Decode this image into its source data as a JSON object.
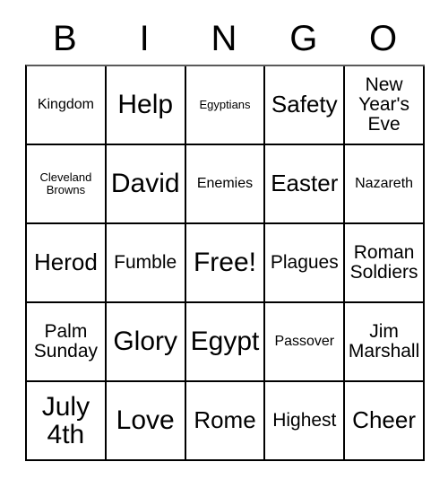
{
  "card": {
    "headers": [
      "B",
      "I",
      "N",
      "G",
      "O"
    ],
    "rows": [
      [
        {
          "text": "Kingdom",
          "size": "s-sm"
        },
        {
          "text": "Help",
          "size": "s-xl"
        },
        {
          "text": "Egyptians",
          "size": "s-xs"
        },
        {
          "text": "Safety",
          "size": "s-lg"
        },
        {
          "text": "New Year's Eve",
          "size": "s-md"
        }
      ],
      [
        {
          "text": "Cleveland Browns",
          "size": "s-xs"
        },
        {
          "text": "David",
          "size": "s-xl"
        },
        {
          "text": "Enemies",
          "size": "s-sm"
        },
        {
          "text": "Easter",
          "size": "s-lg"
        },
        {
          "text": "Nazareth",
          "size": "s-sm"
        }
      ],
      [
        {
          "text": "Herod",
          "size": "s-lg"
        },
        {
          "text": "Fumble",
          "size": "s-md"
        },
        {
          "text": "Free!",
          "size": "s-xl"
        },
        {
          "text": "Plagues",
          "size": "s-md"
        },
        {
          "text": "Roman Soldiers",
          "size": "s-md"
        }
      ],
      [
        {
          "text": "Palm Sunday",
          "size": "s-md"
        },
        {
          "text": "Glory",
          "size": "s-xl"
        },
        {
          "text": "Egypt",
          "size": "s-xl"
        },
        {
          "text": "Passover",
          "size": "s-sm"
        },
        {
          "text": "Jim Marshall",
          "size": "s-md"
        }
      ],
      [
        {
          "text": "July 4th",
          "size": "s-xl"
        },
        {
          "text": "Love",
          "size": "s-xl"
        },
        {
          "text": "Rome",
          "size": "s-lg"
        },
        {
          "text": "Highest",
          "size": "s-md"
        },
        {
          "text": "Cheer",
          "size": "s-lg"
        }
      ]
    ]
  },
  "colors": {
    "background": "#ffffff",
    "text": "#000000",
    "border": "#000000"
  }
}
